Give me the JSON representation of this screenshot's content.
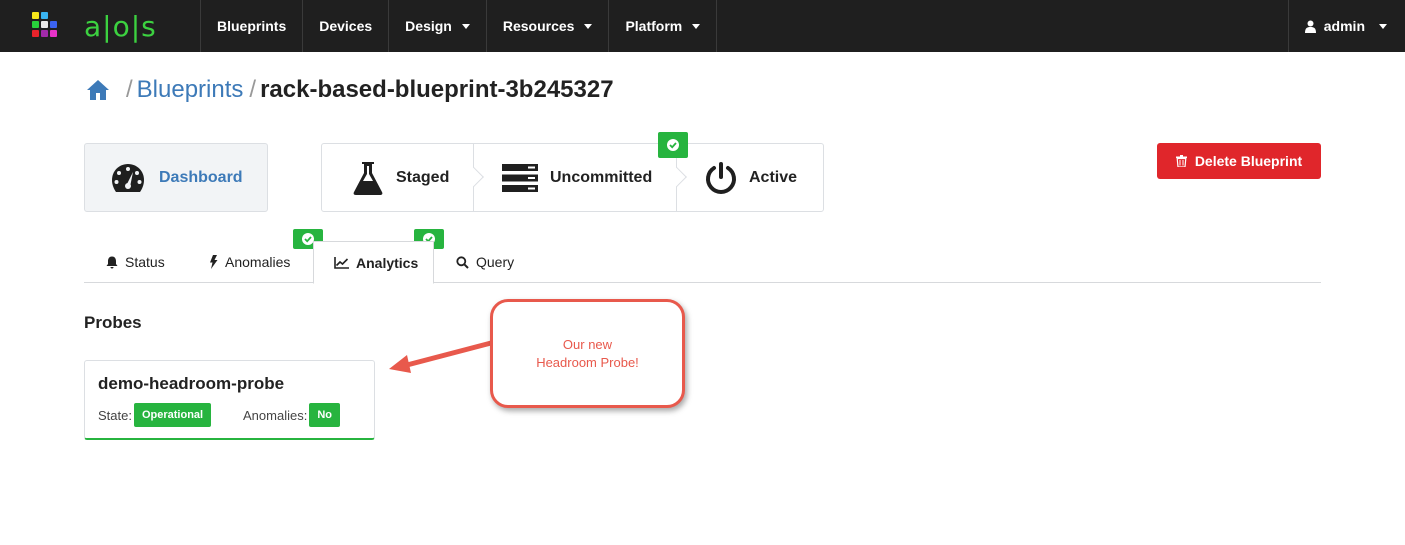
{
  "logo": {
    "text": "a|o|s"
  },
  "nav": {
    "items": [
      {
        "label": "Blueprints",
        "dropdown": false
      },
      {
        "label": "Devices",
        "dropdown": false
      },
      {
        "label": "Design",
        "dropdown": true
      },
      {
        "label": "Resources",
        "dropdown": true
      },
      {
        "label": "Platform",
        "dropdown": true
      }
    ],
    "user": "admin"
  },
  "breadcrumb": {
    "link": "Blueprints",
    "current": "rack-based-blueprint-3b245327",
    "separator": "/"
  },
  "dashboard": {
    "label": "Dashboard"
  },
  "stages": {
    "staged": "Staged",
    "uncommitted": "Uncommitted",
    "active": "Active"
  },
  "delete_button": "Delete Blueprint",
  "tabs": {
    "status": "Status",
    "anomalies": "Anomalies",
    "analytics": "Analytics",
    "query": "Query",
    "active": "analytics"
  },
  "probes": {
    "title": "Probes",
    "items": [
      {
        "name": "demo-headroom-probe",
        "state_label": "State:",
        "state": "Operational",
        "anomalies_label": "Anomalies:",
        "anomalies": "No"
      }
    ]
  },
  "callout": {
    "line1": "Our new",
    "line2": "Headroom Probe!"
  },
  "colors": {
    "accent_blue": "#3d7ab8",
    "success_green": "#27b43f",
    "danger_red": "#e0262b",
    "callout_red": "#e8594c",
    "topbar": "#1f1f1f"
  }
}
